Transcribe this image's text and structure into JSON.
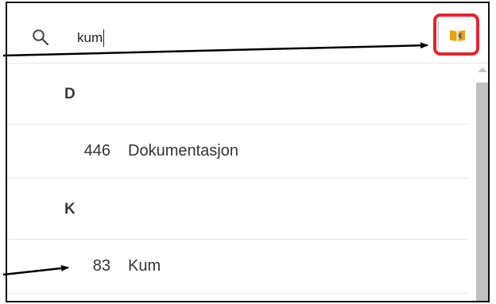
{
  "search": {
    "value": "kum",
    "icon": "search-icon"
  },
  "toolbar": {
    "book_icon": "book-icon",
    "accent": "#e8232a",
    "book_color": "#f0a000"
  },
  "list": {
    "groups": [
      {
        "letter": "D",
        "items": [
          {
            "number": "446",
            "label": "Dokumentasjon"
          }
        ]
      },
      {
        "letter": "K",
        "items": [
          {
            "number": "83",
            "label": "Kum"
          }
        ]
      }
    ]
  }
}
